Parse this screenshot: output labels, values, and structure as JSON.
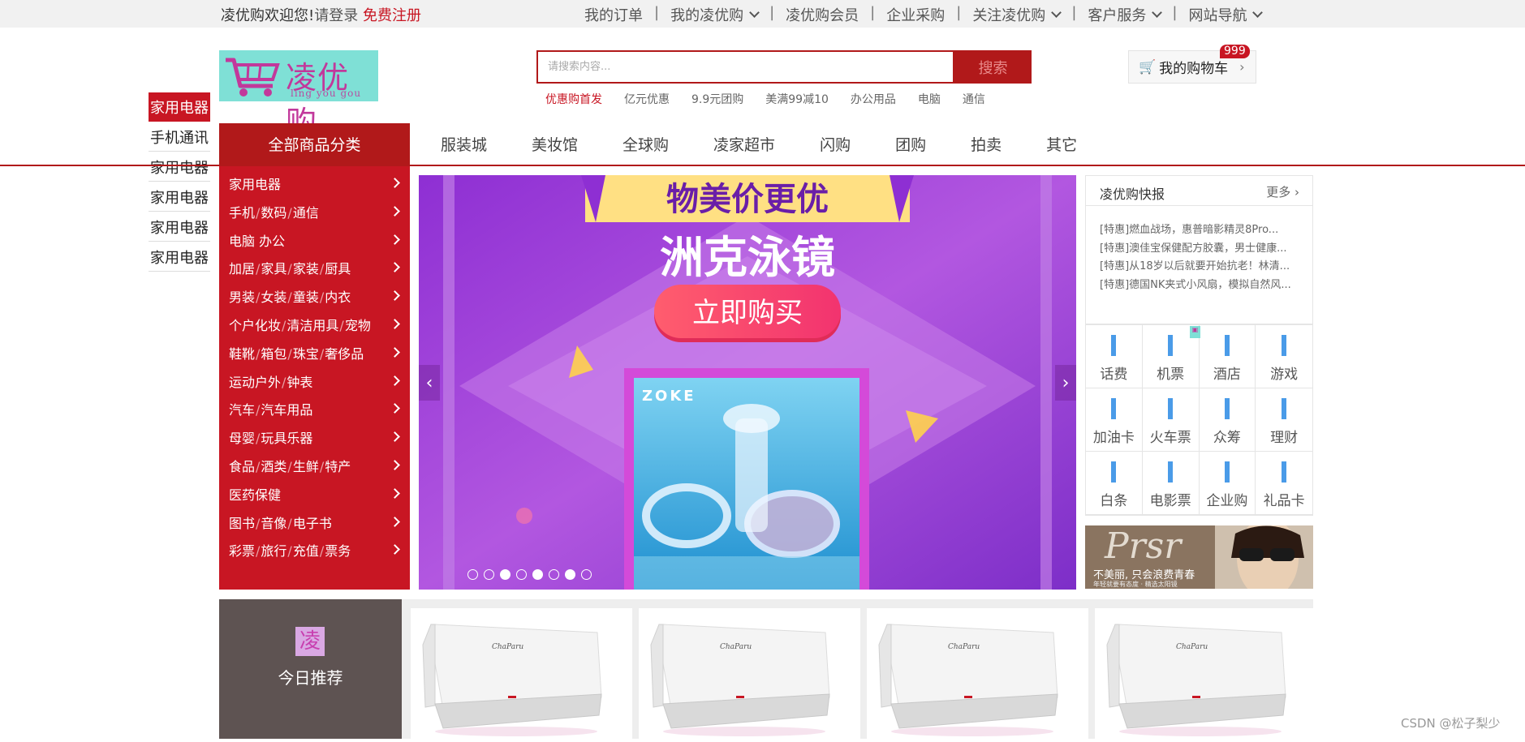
{
  "topbar": {
    "welcome": "凌优购欢迎您!",
    "login": "请登录",
    "register": "免费注册",
    "links": [
      {
        "label": "我的订单",
        "dropdown": false
      },
      {
        "label": "我的凌优购",
        "dropdown": true
      },
      {
        "label": "凌优购会员",
        "dropdown": false
      },
      {
        "label": "企业采购",
        "dropdown": false
      },
      {
        "label": "关注凌优购",
        "dropdown": true
      },
      {
        "label": "客户服务",
        "dropdown": true
      },
      {
        "label": "网站导航",
        "dropdown": true
      }
    ]
  },
  "header": {
    "logo_title": "凌优购",
    "logo_sub": "ling you gou",
    "search_placeholder": "请搜索内容...",
    "search_button": "搜索",
    "hot_words": [
      "优惠购首发",
      "亿元优惠",
      "9.9元团购",
      "美满99减10",
      "办公用品",
      "电脑",
      "通信"
    ],
    "cart_label": "我的购物车",
    "cart_count": "999"
  },
  "floor_nav": [
    "家用电器",
    "手机通讯",
    "家用电器",
    "家用电器",
    "家用电器",
    "家用电器"
  ],
  "nav": {
    "all_categories": "全部商品分类",
    "links": [
      "服装城",
      "美妆馆",
      "全球购",
      "凌家超市",
      "闪购",
      "团购",
      "拍卖",
      "其它"
    ]
  },
  "categories": [
    [
      "家用电器"
    ],
    [
      "手机",
      "数码",
      "通信"
    ],
    [
      "电脑 办公"
    ],
    [
      "加居",
      "家具",
      "家装",
      "厨具"
    ],
    [
      "男装",
      "女装",
      "童装",
      "内衣"
    ],
    [
      "个户化妆",
      "清洁用具",
      "宠物"
    ],
    [
      "鞋靴",
      "箱包",
      "珠宝",
      "奢侈品"
    ],
    [
      "运动户外",
      "钟表"
    ],
    [
      "汽车",
      "汽车用品"
    ],
    [
      "母婴",
      "玩具乐器"
    ],
    [
      "食品",
      "酒类",
      "生鲜",
      "特产"
    ],
    [
      "医药保健"
    ],
    [
      "图书",
      "音像",
      "电子书"
    ],
    [
      "彩票",
      "旅行",
      "充值",
      "票务"
    ]
  ],
  "banner": {
    "ribbon": "物美价更优",
    "headline": "洲克泳镜",
    "cta": "立即购买",
    "brand": "ZOKE",
    "prev": "‹",
    "next": "›",
    "slide_count": 8,
    "active_slides": [
      2,
      4,
      6
    ]
  },
  "news": {
    "title": "凌优购快报",
    "more": "更多",
    "items": [
      "[特惠]燃血战场，惠普暗影精灵8Pro...",
      "[特惠]澳佳宝保健配方胶囊，男士健康...",
      "[特惠]从18岁以后就要开始抗老！林清...",
      "[特惠]德国NK夹式小风扇，模拟自然风..."
    ]
  },
  "services": [
    "话费",
    "机票",
    "酒店",
    "游戏",
    "加油卡",
    "火车票",
    "众筹",
    "理财",
    "白条",
    "电影票",
    "企业购",
    "礼品卡"
  ],
  "ad": {
    "brand": "Prsr",
    "text": "不美丽, 只会浪费青春",
    "small": "年轻就要有态度 · 精选太阳镜"
  },
  "today": {
    "icon_char": "凌",
    "title": "今日推荐"
  },
  "recommend_brand": "ChaParu",
  "watermark": "CSDN @松子梨少",
  "colors": {
    "brand_red": "#c81623",
    "dark_red": "#b1191a",
    "banner_purple": "#a34fd6",
    "logo_cyan": "#7fe0d6"
  }
}
